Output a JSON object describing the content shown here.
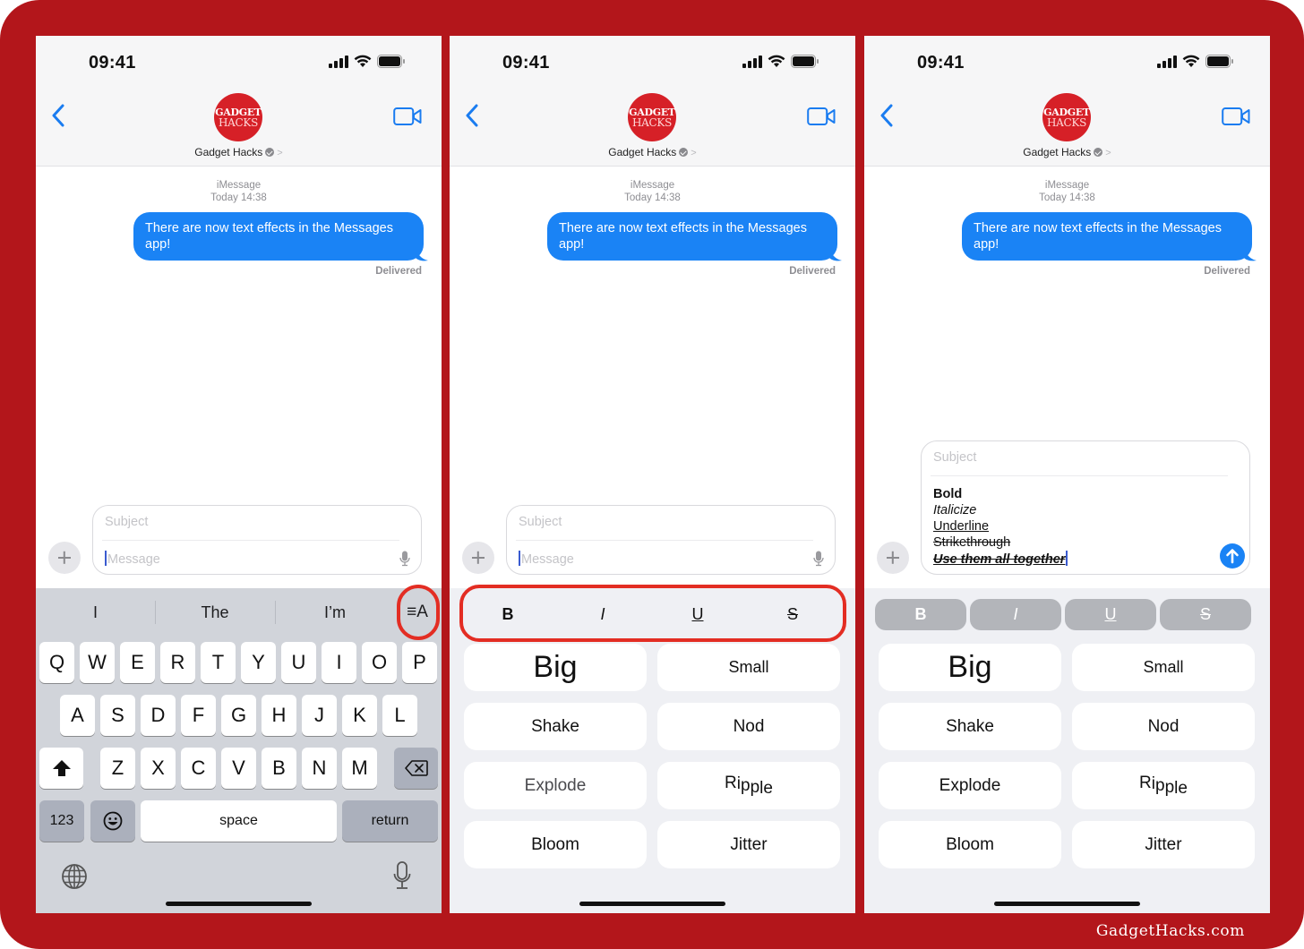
{
  "brand": {
    "frame_color": "#b3161b",
    "accent_blue": "#1a83f5",
    "highlight_ring": "#e32d23",
    "watermark": "GadgetHacks.com"
  },
  "panels": [
    {
      "status": {
        "time": "09:41"
      },
      "header": {
        "contact_name": "Gadget Hacks",
        "avatar_line1": "GADGET",
        "avatar_line2": "HACKS"
      },
      "conversation": {
        "service": "iMessage",
        "timestamp": "Today 14:38",
        "message": "There are now text effects in the Messages app!",
        "receipt": "Delivered"
      },
      "compose": {
        "subject_placeholder": "Subject",
        "message_placeholder": "Message"
      },
      "keyboard": {
        "suggestions": [
          "I",
          "The",
          "I’m"
        ],
        "format_toggle": "≡A",
        "row1": [
          "Q",
          "W",
          "E",
          "R",
          "T",
          "Y",
          "U",
          "I",
          "O",
          "P"
        ],
        "row2": [
          "A",
          "S",
          "D",
          "F",
          "G",
          "H",
          "J",
          "K",
          "L"
        ],
        "row3": [
          "Z",
          "X",
          "C",
          "V",
          "B",
          "N",
          "M"
        ],
        "numbers_key": "123",
        "space_key": "space",
        "return_key": "return"
      }
    },
    {
      "status": {
        "time": "09:41"
      },
      "header": {
        "contact_name": "Gadget Hacks",
        "avatar_line1": "GADGET",
        "avatar_line2": "HACKS"
      },
      "conversation": {
        "service": "iMessage",
        "timestamp": "Today 14:38",
        "message": "There are now text effects in the Messages app!",
        "receipt": "Delivered"
      },
      "compose": {
        "subject_placeholder": "Subject",
        "message_placeholder": "Message"
      },
      "format": {
        "bold": "B",
        "italic": "I",
        "underline": "U",
        "strike": "S"
      },
      "effects": [
        "Big",
        "Small",
        "Shake",
        "Nod",
        "Explode",
        "Ripple",
        "Bloom",
        "Jitter"
      ]
    },
    {
      "status": {
        "time": "09:41"
      },
      "header": {
        "contact_name": "Gadget Hacks",
        "avatar_line1": "GADGET",
        "avatar_line2": "HACKS"
      },
      "conversation": {
        "service": "iMessage",
        "timestamp": "Today 14:38",
        "message": "There are now text effects in the Messages app!",
        "receipt": "Delivered"
      },
      "compose": {
        "subject_placeholder": "Subject",
        "lines": [
          "Bold",
          "Italicize",
          "Underline",
          "Strikethrough",
          "Use them all together"
        ]
      },
      "format": {
        "bold": "B",
        "italic": "I",
        "underline": "U",
        "strike": "S"
      },
      "effects": [
        "Big",
        "Small",
        "Shake",
        "Nod",
        "Explode",
        "Ripple",
        "Bloom",
        "Jitter"
      ]
    }
  ]
}
